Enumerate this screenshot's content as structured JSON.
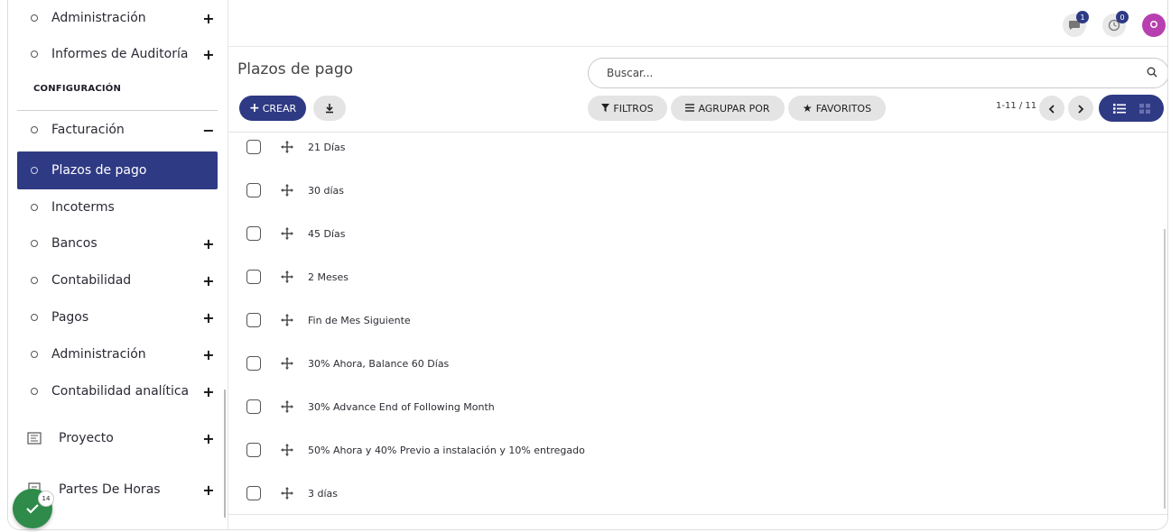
{
  "sidebar": {
    "top_items": [
      {
        "label": "Administración",
        "toggle": "+"
      },
      {
        "label": "Informes de Auditoría",
        "toggle": "+"
      }
    ],
    "section_title": "CONFIGURACIÓN",
    "items": [
      {
        "label": "Facturación",
        "toggle": "−"
      },
      {
        "label": "Plazos de pago",
        "toggle": ""
      },
      {
        "label": "Incoterms",
        "toggle": ""
      },
      {
        "label": "Bancos",
        "toggle": "+"
      },
      {
        "label": "Contabilidad",
        "toggle": "+"
      },
      {
        "label": "Pagos",
        "toggle": "+"
      },
      {
        "label": "Administración",
        "toggle": "+"
      },
      {
        "label": "Contabilidad analítica",
        "toggle": "+"
      }
    ],
    "apps": [
      {
        "label": "Proyecto",
        "toggle": "+",
        "icon": "project-icon"
      },
      {
        "label": "Partes De Horas",
        "toggle": "+",
        "icon": "timesheet-icon"
      }
    ],
    "fab_badge": "14"
  },
  "topbar": {
    "messages_badge": "1",
    "activities_badge": "0"
  },
  "page": {
    "title": "Plazos de pago",
    "search_placeholder": "Buscar...",
    "create_label": "CREAR",
    "filters_label": "FILTROS",
    "group_by_label": "AGRUPAR POR",
    "favorites_label": "FAVORITOS",
    "pager": "1-11 / 11"
  },
  "records": [
    "21 Días",
    "30 días",
    "45 Días",
    "2 Meses",
    "Fin de Mes Siguiente",
    "30% Ahora, Balance 60 Días",
    "30% Advance End of Following Month",
    "50% Ahora y 40% Previo a instalación y 10% entregado",
    "3 días"
  ],
  "colors": {
    "primary": "#2f3a84",
    "avatar": "#b83fb0",
    "fab": "#2e8b4a"
  }
}
